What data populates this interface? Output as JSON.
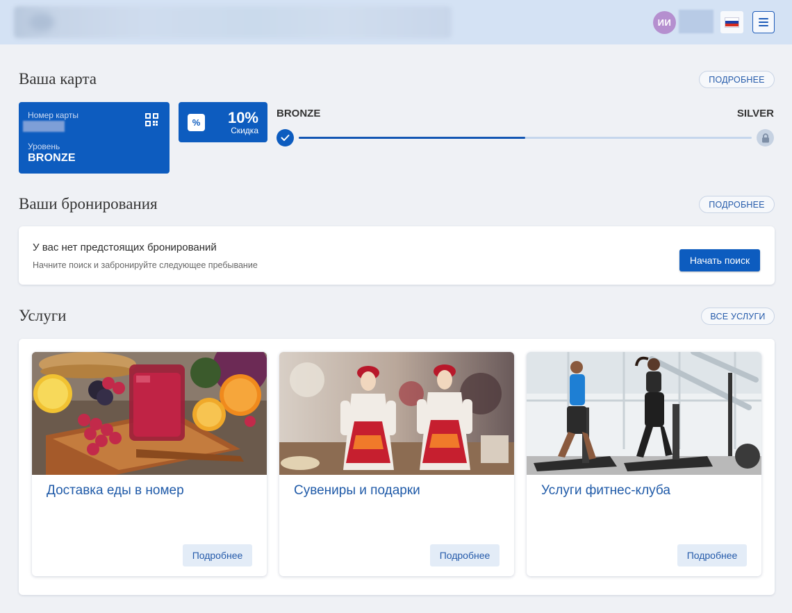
{
  "header": {
    "avatar_initials": "ИИ",
    "flag_colors": [
      "#ffffff",
      "#1c3ea8",
      "#d52b1e"
    ]
  },
  "card_section": {
    "title": "Ваша карта",
    "more_label": "ПОДРОБНЕЕ",
    "card_number_label": "Номер карты",
    "level_label": "Уровень",
    "level_value": "BRONZE",
    "discount_value": "10%",
    "discount_label": "Скидка",
    "discount_icon_glyph": "%",
    "tier_current": "BRONZE",
    "tier_next": "SILVER",
    "tier_progress": 0.5
  },
  "bookings_section": {
    "title": "Ваши бронирования",
    "more_label": "ПОДРОБНЕЕ",
    "empty_title": "У вас нет предстоящих бронирований",
    "empty_subtitle": "Начните поиск и забронируйте следующее пребывание",
    "search_button": "Начать поиск"
  },
  "services_section": {
    "title": "Услуги",
    "all_label": "ВСЕ УСЛУГИ",
    "items": [
      {
        "name": "Доставка еды в номер",
        "more": "Подробнее"
      },
      {
        "name": "Сувениры и подарки",
        "more": "Подробнее"
      },
      {
        "name": "Услуги фитнес-клуба",
        "more": "Подробнее"
      }
    ]
  },
  "colors": {
    "brand_blue": "#0d5cbf",
    "header_bg": "#d4e2f4",
    "page_bg": "#eff1f5",
    "link_blue": "#1f5aa8",
    "avatar_bg": "#b58fcf"
  }
}
